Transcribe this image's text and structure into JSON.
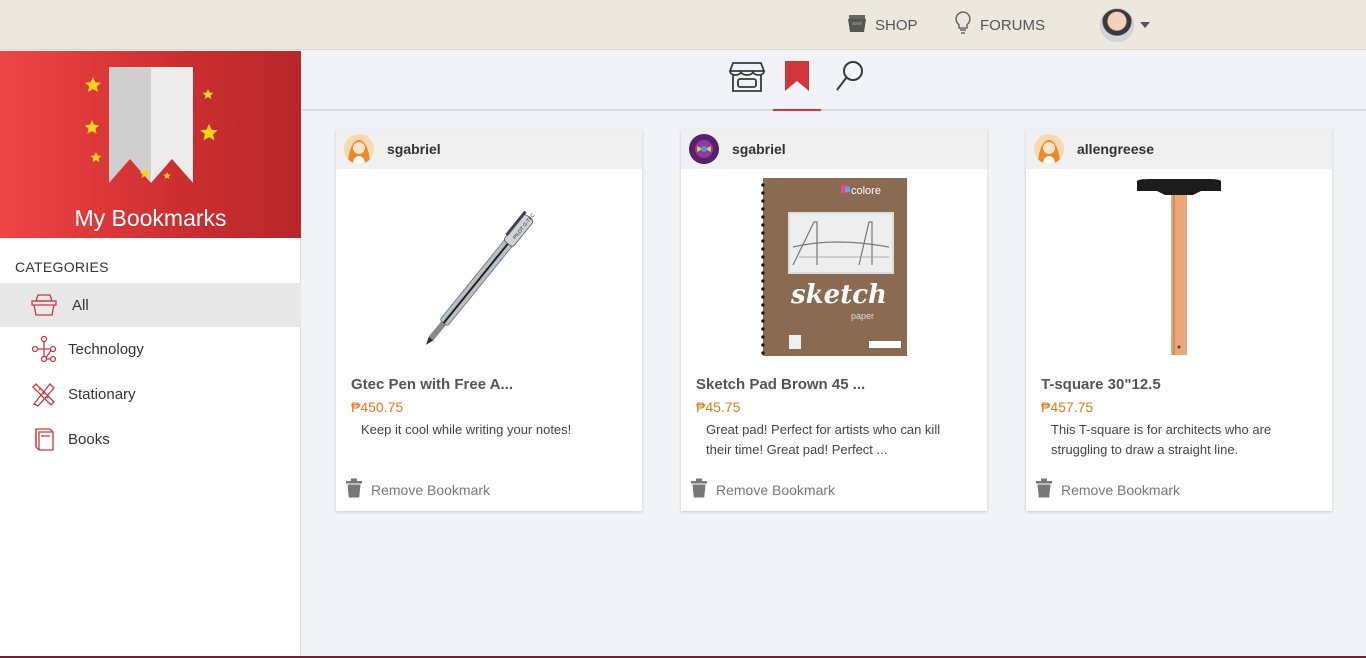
{
  "topbar": {
    "shop_label": "SHOP",
    "forums_label": "FORUMS"
  },
  "sidebar": {
    "title": "My Bookmarks",
    "categories_heading": "CATEGORIES",
    "items": [
      {
        "label": "All",
        "icon": "shopping-basket-icon",
        "active": true
      },
      {
        "label": "Technology",
        "icon": "circuit-icon",
        "active": false
      },
      {
        "label": "Stationary",
        "icon": "pencil-ruler-icon",
        "active": false
      },
      {
        "label": "Books",
        "icon": "book-icon",
        "active": false
      }
    ]
  },
  "tabs": [
    {
      "icon": "store-icon",
      "active": false
    },
    {
      "icon": "bookmark-icon",
      "active": true
    },
    {
      "icon": "search-icon",
      "active": false
    }
  ],
  "cards": [
    {
      "user": "sgabriel",
      "title": "Gtec Pen with Free A...",
      "price": "₱450.75",
      "description": "Keep it cool while writing your notes!",
      "remove_label": "Remove Bookmark",
      "image": "gel-pen"
    },
    {
      "user": "sgabriel",
      "title": "Sketch Pad Brown 45 ...",
      "price": "₱45.75",
      "description": "Great pad! Perfect for artists who can kill their time! Great pad! Perfect ...",
      "remove_label": "Remove Bookmark",
      "image": "sketch-pad",
      "image_text": {
        "brand": "colore",
        "main": "sketch",
        "sub": "paper"
      }
    },
    {
      "user": "allengreese",
      "title": "T-square 30\"12.5",
      "price": "₱457.75",
      "description": "This T-square is for architects who are struggling to draw a straight line.",
      "remove_label": "Remove Bookmark",
      "image": "t-square"
    }
  ],
  "colors": {
    "accent": "#d0363b",
    "price": "#e07b1a",
    "star": "#f5d21e"
  }
}
